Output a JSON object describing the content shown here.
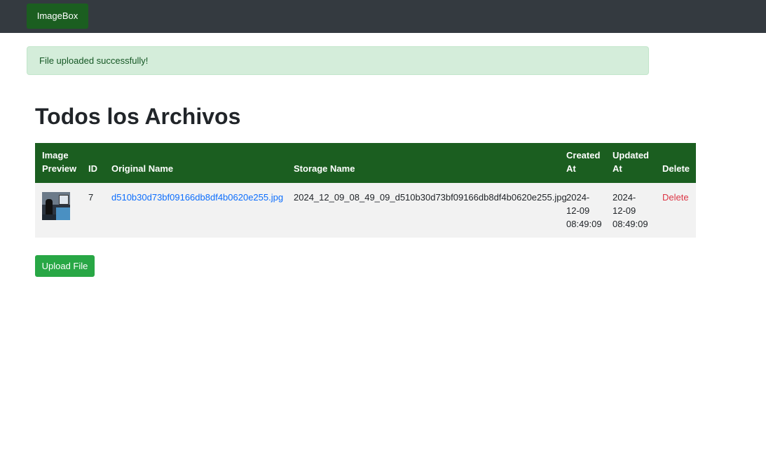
{
  "navbar": {
    "brand": "ImageBox",
    "background": "#343a40",
    "brand_color": "#1b5e20"
  },
  "alert": {
    "message": "File uploaded successfully!",
    "background": "#d4edda"
  },
  "page": {
    "title": "Todos los Archivos"
  },
  "table": {
    "header_color": "#1b5e20",
    "columns": {
      "preview": "Image Preview",
      "id": "ID",
      "original_name": "Original Name",
      "storage_name": "Storage Name",
      "created_at": "Created At",
      "updated_at": "Updated At",
      "delete": "Delete"
    },
    "rows": [
      {
        "id": "7",
        "original_name": "d510b30d73bf09166db8df4b0620e255.jpg",
        "storage_name": "2024_12_09_08_49_09_d510b30d73bf09166db8df4b0620e255.jpg",
        "created_at": "2024-12-09 08:49:09",
        "updated_at": "2024-12-09 08:49:09",
        "delete_label": "Delete",
        "preview_icon": "image-thumbnail"
      }
    ]
  },
  "actions": {
    "upload_label": "Upload File",
    "upload_color": "#28a745"
  }
}
